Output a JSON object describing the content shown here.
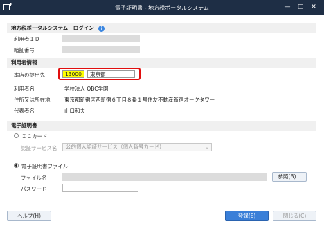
{
  "window": {
    "title": "電子証明書 - 地方税ポータルシステム",
    "controls": {
      "minimize": "—",
      "restore": "□",
      "close": "✕"
    }
  },
  "login_section": {
    "heading": "地方税ポータルシステム　ログイン",
    "user_id_label": "利用者ＩＤ",
    "password_label": "暗証番号"
  },
  "user_info": {
    "heading": "利用者情報",
    "submit_to_label": "本店の提出先",
    "code_value": "13000",
    "prefecture_value": "東京都",
    "user_name_label": "利用者名",
    "user_name_value": "学校法人 OBC学園",
    "address_label": "住所又は所在地",
    "address_value": "東京都新宿区西新宿６丁目８番１号住友不動産新宿オークタワー",
    "rep_label": "代表者名",
    "rep_value": "山口和夫"
  },
  "cert_section": {
    "heading": "電子証明書",
    "ic_card_label": "ＩＣカード",
    "auth_service_label": "認証サービス名",
    "auth_service_value": "公的個人認証サービス（個人番号カード）",
    "file_option_label": "電子証明書ファイル",
    "file_name_label": "ファイル名",
    "browse_label": "参照(B)...",
    "password_label": "パスワード"
  },
  "footer": {
    "help_label": "ヘルプ(H)",
    "register_label": "登録(E)",
    "close_label": "閉じる(C)"
  },
  "colors": {
    "titlebar": "#1e2e45",
    "accent": "#3a7fd8",
    "highlight": "#ffff00",
    "red_box": "#e10e0e"
  },
  "selection": {
    "ic_card": false,
    "cert_file": true
  }
}
